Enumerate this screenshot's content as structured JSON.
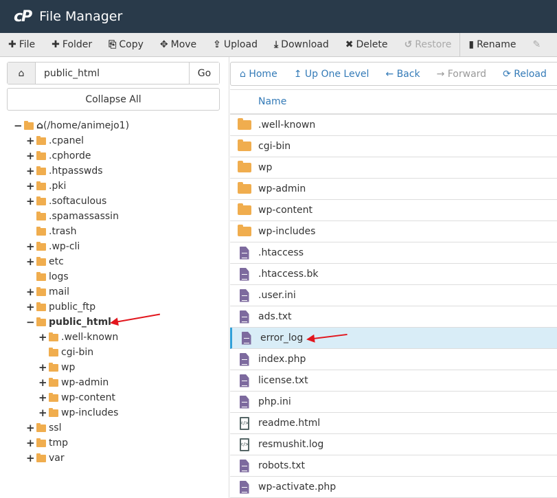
{
  "header": {
    "logo": "cP",
    "title": "File Manager"
  },
  "toolbar": [
    {
      "icon": "plus-icon",
      "glyph": "✚",
      "label": "File",
      "disabled": false
    },
    {
      "icon": "plus-icon",
      "glyph": "✚",
      "label": "Folder",
      "disabled": false
    },
    {
      "icon": "copy-icon",
      "glyph": "⎘",
      "label": "Copy",
      "disabled": false
    },
    {
      "icon": "move-icon",
      "glyph": "✥",
      "label": "Move",
      "disabled": false
    },
    {
      "icon": "upload-icon",
      "glyph": "⇪",
      "label": "Upload",
      "disabled": false
    },
    {
      "icon": "download-icon",
      "glyph": "⤓",
      "label": "Download",
      "disabled": false
    },
    {
      "icon": "delete-icon",
      "glyph": "✖",
      "label": "Delete",
      "disabled": false
    },
    {
      "icon": "restore-icon",
      "glyph": "↺",
      "label": "Restore",
      "disabled": true
    },
    {
      "icon": "rename-icon",
      "glyph": "▮",
      "label": "Rename",
      "disabled": false
    },
    {
      "icon": "edit-icon",
      "glyph": "✎",
      "label": "",
      "disabled": true
    }
  ],
  "path": {
    "value": "public_html",
    "go": "Go"
  },
  "collapse_all": "Collapse All",
  "tree": [
    {
      "level": 0,
      "toggle": "−",
      "open": true,
      "home": true,
      "label": "(/home/animejo1)"
    },
    {
      "level": 1,
      "toggle": "+",
      "label": ".cpanel"
    },
    {
      "level": 1,
      "toggle": "+",
      "label": ".cphorde"
    },
    {
      "level": 1,
      "toggle": "+",
      "label": ".htpasswds"
    },
    {
      "level": 1,
      "toggle": "+",
      "label": ".pki"
    },
    {
      "level": 1,
      "toggle": "+",
      "label": ".softaculous"
    },
    {
      "level": 1,
      "toggle": "",
      "label": ".spamassassin"
    },
    {
      "level": 1,
      "toggle": "",
      "label": ".trash"
    },
    {
      "level": 1,
      "toggle": "+",
      "label": ".wp-cli"
    },
    {
      "level": 1,
      "toggle": "+",
      "label": "etc"
    },
    {
      "level": 1,
      "toggle": "",
      "label": "logs"
    },
    {
      "level": 1,
      "toggle": "+",
      "label": "mail"
    },
    {
      "level": 1,
      "toggle": "+",
      "label": "public_ftp"
    },
    {
      "level": 1,
      "toggle": "−",
      "open": true,
      "bold": true,
      "label": "public_html"
    },
    {
      "level": 2,
      "toggle": "+",
      "label": ".well-known"
    },
    {
      "level": 2,
      "toggle": "",
      "label": "cgi-bin"
    },
    {
      "level": 2,
      "toggle": "+",
      "label": "wp"
    },
    {
      "level": 2,
      "toggle": "+",
      "label": "wp-admin"
    },
    {
      "level": 2,
      "toggle": "+",
      "label": "wp-content"
    },
    {
      "level": 2,
      "toggle": "+",
      "label": "wp-includes"
    },
    {
      "level": 1,
      "toggle": "+",
      "label": "ssl"
    },
    {
      "level": 1,
      "toggle": "+",
      "label": "tmp"
    },
    {
      "level": 1,
      "toggle": "+",
      "label": "var"
    }
  ],
  "nav": [
    {
      "icon": "home-icon",
      "glyph": "⌂",
      "label": "Home",
      "disabled": false
    },
    {
      "icon": "up-icon",
      "glyph": "↥",
      "label": "Up One Level",
      "disabled": false
    },
    {
      "icon": "back-icon",
      "glyph": "←",
      "label": "Back",
      "disabled": false
    },
    {
      "icon": "forward-icon",
      "glyph": "→",
      "label": "Forward",
      "disabled": true
    },
    {
      "icon": "reload-icon",
      "glyph": "⟳",
      "label": "Reload",
      "disabled": false
    }
  ],
  "table": {
    "header": "Name",
    "rows": [
      {
        "type": "folder",
        "name": ".well-known"
      },
      {
        "type": "folder",
        "name": "cgi-bin"
      },
      {
        "type": "folder",
        "name": "wp"
      },
      {
        "type": "folder",
        "name": "wp-admin"
      },
      {
        "type": "folder",
        "name": "wp-content"
      },
      {
        "type": "folder",
        "name": "wp-includes"
      },
      {
        "type": "text",
        "name": ".htaccess"
      },
      {
        "type": "text",
        "name": ".htaccess.bk"
      },
      {
        "type": "text",
        "name": ".user.ini"
      },
      {
        "type": "text",
        "name": "ads.txt"
      },
      {
        "type": "text",
        "name": "error_log",
        "selected": true
      },
      {
        "type": "text",
        "name": "index.php"
      },
      {
        "type": "text",
        "name": "license.txt"
      },
      {
        "type": "text",
        "name": "php.ini"
      },
      {
        "type": "code",
        "name": "readme.html"
      },
      {
        "type": "code",
        "name": "resmushit.log"
      },
      {
        "type": "text",
        "name": "robots.txt"
      },
      {
        "type": "text",
        "name": "wp-activate.php"
      }
    ]
  },
  "colors": {
    "header_bg": "#293a4a",
    "link": "#337ab7",
    "folder": "#f0ad4e",
    "file": "#7d6a9e",
    "selected_row": "#d9edf7",
    "annotation_arrow": "#e2161d"
  }
}
